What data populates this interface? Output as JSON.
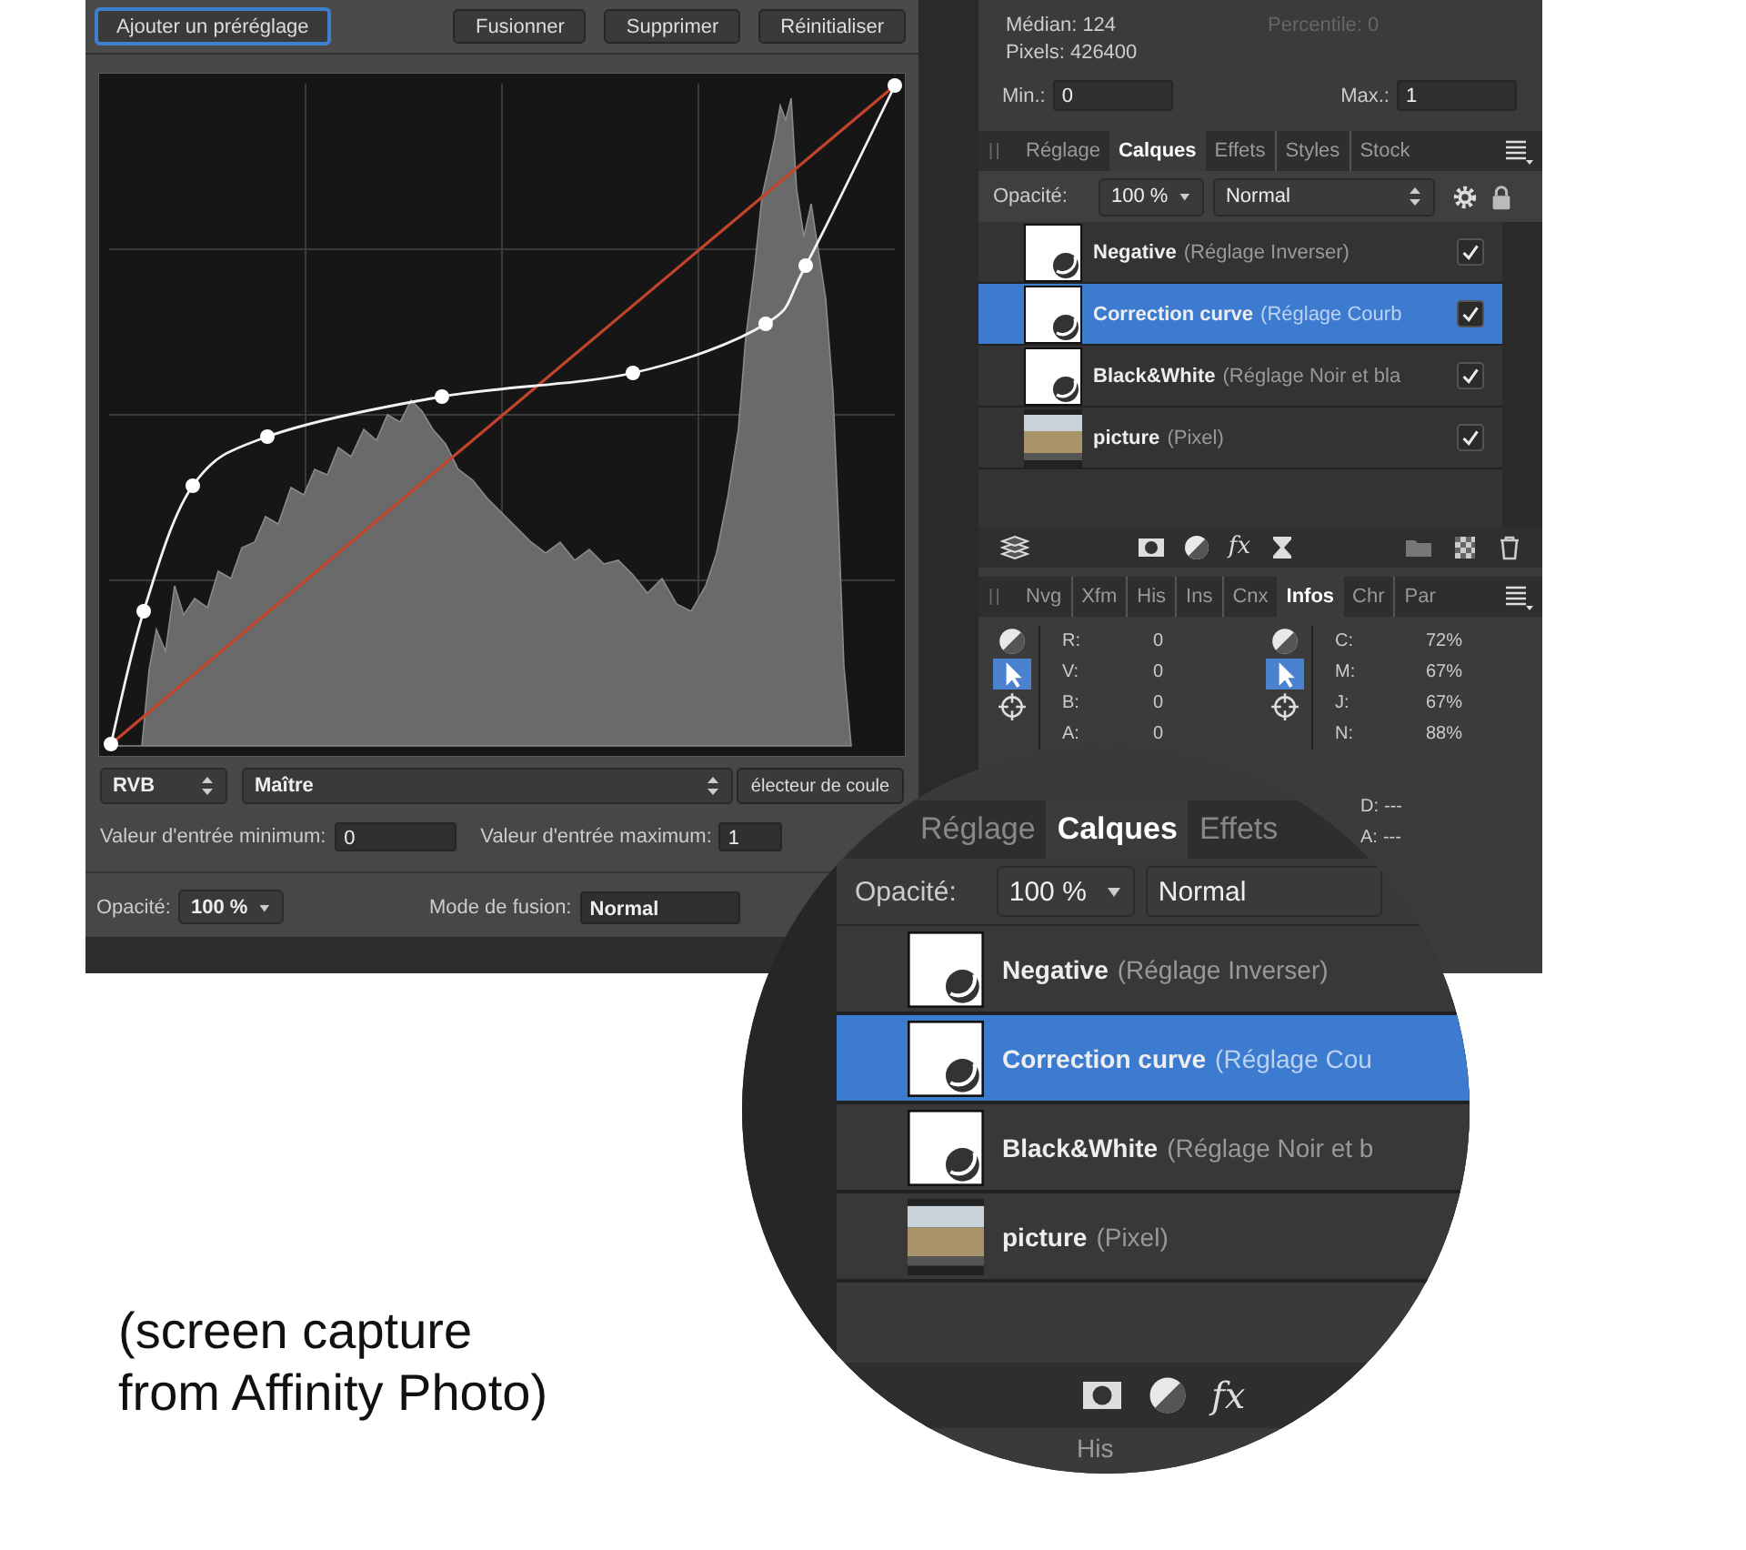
{
  "preset_bar": {
    "buttons": [
      {
        "label": "Ajouter un préréglage",
        "focused": true
      },
      {
        "label": "Fusionner",
        "focused": false
      },
      {
        "label": "Supprimer",
        "focused": false
      },
      {
        "label": "Réinitialiser",
        "focused": false
      }
    ]
  },
  "curves": {
    "channel": "RVB",
    "target": "Maître",
    "picker_button": "électeur de coule",
    "min_label": "Valeur d'entrée minimum:",
    "min_value": "0",
    "max_label": "Valeur d'entrée maximum:",
    "max_value": "1"
  },
  "blend": {
    "opacity_label": "Opacité:",
    "opacity": "100 %",
    "mode_label": "Mode de fusion:",
    "mode": "Normal"
  },
  "histogram_stats": {
    "lines": [
      {
        "text": "Médian: 124",
        "disabled": false
      },
      {
        "text": "Percentile: 0",
        "disabled": true
      },
      {
        "text": "Pixels: 426400",
        "disabled": false
      }
    ],
    "min": {
      "label": "Min.:",
      "value": "0"
    },
    "max": {
      "label": "Max.:",
      "value": "1"
    }
  },
  "layers_panel": {
    "tabs": [
      {
        "label": "Réglage",
        "selected": false
      },
      {
        "label": "Calques",
        "selected": true
      },
      {
        "label": "Effets",
        "selected": false
      },
      {
        "label": "Styles",
        "selected": false
      },
      {
        "label": "Stock",
        "selected": false
      }
    ],
    "opacity_label": "Opacité:",
    "opacity": "100 %",
    "blend_mode": "Normal",
    "layers": [
      {
        "name": "Negative",
        "detail": "(Réglage Inverser)",
        "kind": "adjustment",
        "selected": false,
        "visible": true
      },
      {
        "name": "Correction curve",
        "detail": "(Réglage Courb",
        "kind": "adjustment",
        "selected": true,
        "visible": true
      },
      {
        "name": "Black&White",
        "detail": "(Réglage Noir et bla",
        "kind": "adjustment",
        "selected": false,
        "visible": true
      },
      {
        "name": "picture",
        "detail": "(Pixel)",
        "kind": "pixel",
        "selected": false,
        "visible": true
      }
    ],
    "toolbar": [
      [
        {
          "kind": "layers"
        }
      ],
      [
        {
          "kind": "mask"
        },
        {
          "kind": "adjust"
        },
        {
          "kind": "fx",
          "label": "fx"
        },
        {
          "kind": "hourglass"
        }
      ],
      [
        {
          "kind": "folder"
        },
        {
          "kind": "new-pixel"
        },
        {
          "kind": "trash"
        }
      ]
    ]
  },
  "info_panel": {
    "tabs": [
      {
        "label": "Nvg",
        "selected": false
      },
      {
        "label": "Xfm",
        "selected": false
      },
      {
        "label": "His",
        "selected": false
      },
      {
        "label": "Ins",
        "selected": false
      },
      {
        "label": "Cnx",
        "selected": false
      },
      {
        "label": "Infos",
        "selected": true
      },
      {
        "label": "Chr",
        "selected": false
      },
      {
        "label": "Par",
        "selected": false
      }
    ],
    "groups": [
      {
        "tools": [
          {
            "kind": "contrast",
            "selected": false
          },
          {
            "kind": "pointer",
            "selected": true
          },
          {
            "kind": "crosshair",
            "selected": false
          }
        ],
        "values": [
          {
            "label": "R:",
            "value": "0"
          },
          {
            "label": "V:",
            "value": "0"
          },
          {
            "label": "B:",
            "value": "0"
          },
          {
            "label": "A:",
            "value": "0"
          }
        ]
      },
      {
        "tools": [
          {
            "kind": "contrast",
            "selected": false
          },
          {
            "kind": "pointer",
            "selected": true
          },
          {
            "kind": "crosshair",
            "selected": false
          }
        ],
        "values": [
          {
            "label": "C:",
            "value": "72%"
          },
          {
            "label": "M:",
            "value": "67%"
          },
          {
            "label": "J:",
            "value": "67%"
          },
          {
            "label": "N:",
            "value": "88%"
          }
        ]
      }
    ],
    "extra": [
      {
        "label": "D:",
        "value": "---"
      },
      {
        "label": "A:",
        "value": "---"
      }
    ]
  },
  "magnifier": {
    "tabs": [
      {
        "label": "Réglage",
        "selected": false
      },
      {
        "label": "Calques",
        "selected": true
      },
      {
        "label": "Effets",
        "selected": false
      }
    ],
    "opacity_label": "Opacité:",
    "opacity": "100 %",
    "blend_mode": "Normal",
    "layers": [
      {
        "name": "Negative",
        "detail": "(Réglage Inverser)",
        "kind": "adjustment",
        "selected": false
      },
      {
        "name": "Correction curve",
        "detail": "(Réglage Cou",
        "kind": "adjustment",
        "selected": true
      },
      {
        "name": "Black&White",
        "detail": "(Réglage Noir et b",
        "kind": "adjustment",
        "selected": false
      },
      {
        "name": "picture",
        "detail": "(Pixel)",
        "kind": "pixel",
        "selected": false
      }
    ],
    "toolbar": [
      {
        "kind": "mask"
      },
      {
        "kind": "adjust"
      },
      {
        "kind": "fx",
        "label": "fx"
      }
    ],
    "bottom_tabs": [
      {
        "label": "His",
        "selected": false
      }
    ]
  },
  "caption": "(screen capture\nfrom Affinity Photo)"
}
